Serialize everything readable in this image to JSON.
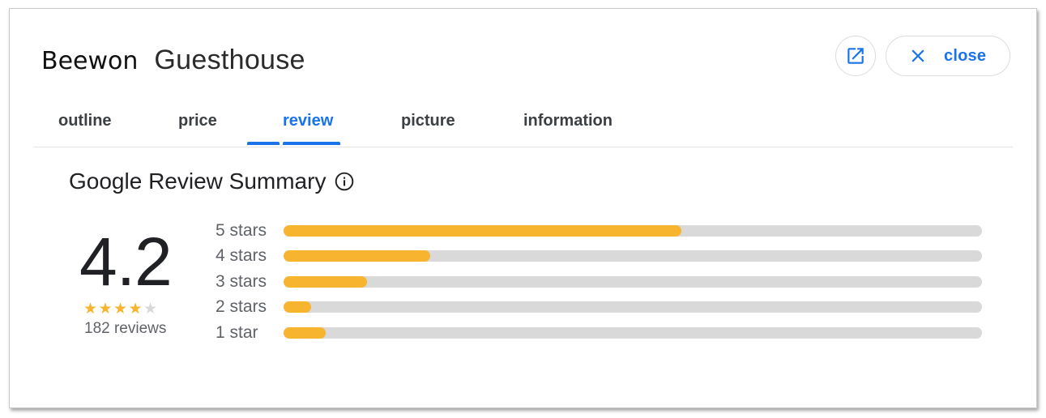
{
  "header": {
    "title_first": "Beewon",
    "title_second": "Guesthouse",
    "open_icon": "open-in-new-icon",
    "close_icon": "close-icon",
    "close_label": "close"
  },
  "tabs": [
    {
      "label": "outline",
      "active": false
    },
    {
      "label": "price",
      "active": false
    },
    {
      "label": "review",
      "active": true
    },
    {
      "label": "picture",
      "active": false
    },
    {
      "label": "information",
      "active": false
    }
  ],
  "summary": {
    "title": "Google Review Summary",
    "info_icon": "info-icon",
    "rating": "4.2",
    "stars_filled": 4,
    "stars_total": 5,
    "reviews_label": "182 reviews",
    "distribution": [
      {
        "label": "5 stars",
        "fraction": 0.57
      },
      {
        "label": "4 stars",
        "fraction": 0.21
      },
      {
        "label": "3 stars",
        "fraction": 0.12
      },
      {
        "label": "2 stars",
        "fraction": 0.04
      },
      {
        "label": "1 star",
        "fraction": 0.06
      }
    ]
  },
  "colors": {
    "accent": "#1a73e8",
    "star": "#f6b42f",
    "star_empty": "#d8d8d8",
    "bar_fill": "#f6b42f",
    "bar_track": "#d9d9d9"
  }
}
